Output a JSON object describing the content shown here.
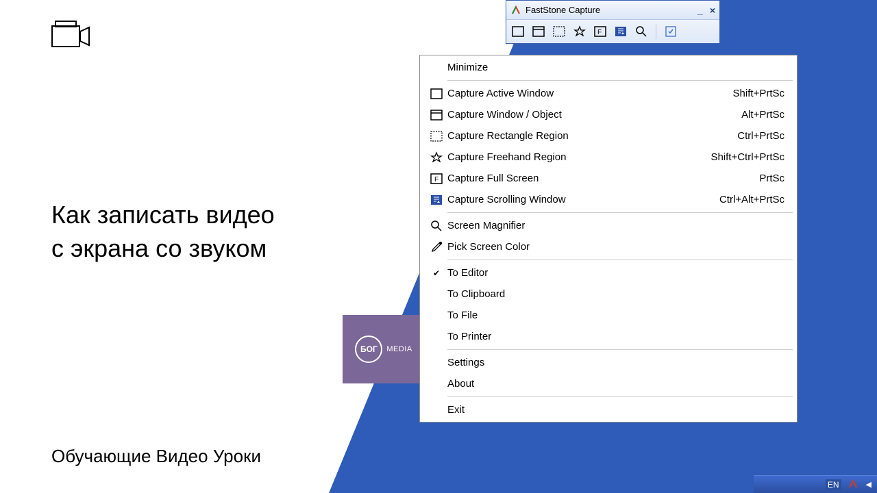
{
  "left": {
    "title_line1": "Как записать видео",
    "title_line2": "с экрана со звуком",
    "subtitle": "Обучающие Видео Уроки"
  },
  "logo": {
    "circle_text": "БОГ",
    "label": "MEDIA"
  },
  "window": {
    "title": "FastStone Capture"
  },
  "menu": {
    "minimize": "Minimize",
    "items": [
      {
        "icon": "rect-icon",
        "label": "Capture Active Window",
        "shortcut": "Shift+PrtSc"
      },
      {
        "icon": "window-icon",
        "label": "Capture Window / Object",
        "shortcut": "Alt+PrtSc"
      },
      {
        "icon": "marquee-icon",
        "label": "Capture Rectangle Region",
        "shortcut": "Ctrl+PrtSc"
      },
      {
        "icon": "freehand-icon",
        "label": "Capture Freehand Region",
        "shortcut": "Shift+Ctrl+PrtSc"
      },
      {
        "icon": "fullscreen-icon",
        "label": "Capture Full Screen",
        "shortcut": "PrtSc"
      },
      {
        "icon": "scroll-icon",
        "label": "Capture Scrolling Window",
        "shortcut": "Ctrl+Alt+PrtSc"
      }
    ],
    "magnifier": "Screen Magnifier",
    "picker": "Pick Screen Color",
    "to_editor": "To Editor",
    "to_clipboard": "To Clipboard",
    "to_file": "To File",
    "to_printer": "To Printer",
    "settings": "Settings",
    "about": "About",
    "exit": "Exit"
  },
  "taskbar": {
    "lang": "EN"
  }
}
